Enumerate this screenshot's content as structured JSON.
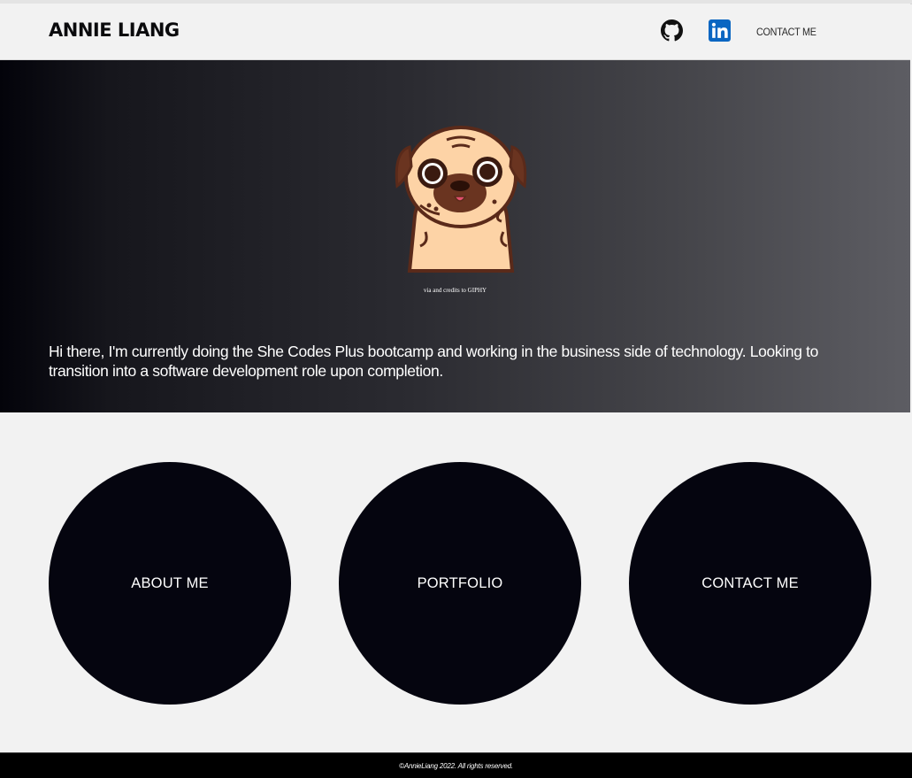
{
  "header": {
    "brand": "ANNIE LIANG",
    "github_icon": "github-icon",
    "linkedin_icon": "linkedin-icon",
    "contact_link": "CONTACT ME"
  },
  "hero": {
    "image_icon": "pug-gif",
    "credit": "via and credits to GIPHY",
    "intro": "Hi there, I'm currently doing the She Codes Plus bootcamp and working in the business side of technology. Looking to transition into a software development role upon completion."
  },
  "sections": [
    {
      "label": "ABOUT ME"
    },
    {
      "label": "PORTFOLIO"
    },
    {
      "label": "CONTACT ME"
    }
  ],
  "footer": {
    "copyright": "©AnnieLiang 2022. All rights reserved."
  },
  "colors": {
    "circle": "#05050f",
    "hero_dark": "#03030a",
    "hero_light": "#5d5d63",
    "linkedin_blue": "#0a66c2"
  }
}
